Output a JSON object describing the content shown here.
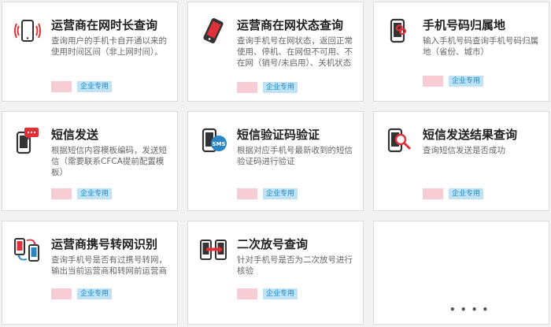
{
  "colors": {
    "accent_red": "#e0303a",
    "badge_bg": "#bfe3f5",
    "badge_text": "#2a86c4",
    "pink_block": "#f7ccd5"
  },
  "cards": [
    {
      "title": "运营商在网时长查询",
      "desc": "查询用户的手机卡自开通以来的使用时间区间（非上网时间）。",
      "badge": "企业专用",
      "icon": "phone-signal-icon"
    },
    {
      "title": "运营商在网状态查询",
      "desc": "查询手机号在网状态，返回正常使用、停机、在网但不可用、不在网（销号/未启用）、关机状态",
      "badge": "企业专用",
      "icon": "phone-tilted-icon"
    },
    {
      "title": "手机号码归属地",
      "desc": "输入手机号码查询手机号码归属地（省份、城市）",
      "badge": "企业专用",
      "icon": "phone-link-icon"
    },
    {
      "title": "短信发送",
      "desc": "根据短信内容模板编码，发送短信（需要联系CFCA提前配置模板）",
      "badge": "企业专用",
      "icon": "phone-message-icon"
    },
    {
      "title": "短信验证码验证",
      "desc": "根据对应手机号最新收到的短信验证码进行验证",
      "badge": "企业专用",
      "icon": "phone-sms-icon"
    },
    {
      "title": "短信发送结果查询",
      "desc": "查询短信发送是否成功",
      "badge": "企业专用",
      "icon": "phone-search-icon"
    },
    {
      "title": "运营商携号转网识别",
      "desc": "查询手机号是否有过携号转网，输出当前运营商和转网前运营商",
      "badge": "企业专用",
      "icon": "phone-transfer-icon"
    },
    {
      "title": "二次放号查询",
      "desc": "针对手机号是否为二次放号进行核验",
      "badge": "企业专用",
      "icon": "phone-swap-icon"
    }
  ],
  "more": {
    "label": "• • • •",
    "icon": "more-dots-icon"
  }
}
